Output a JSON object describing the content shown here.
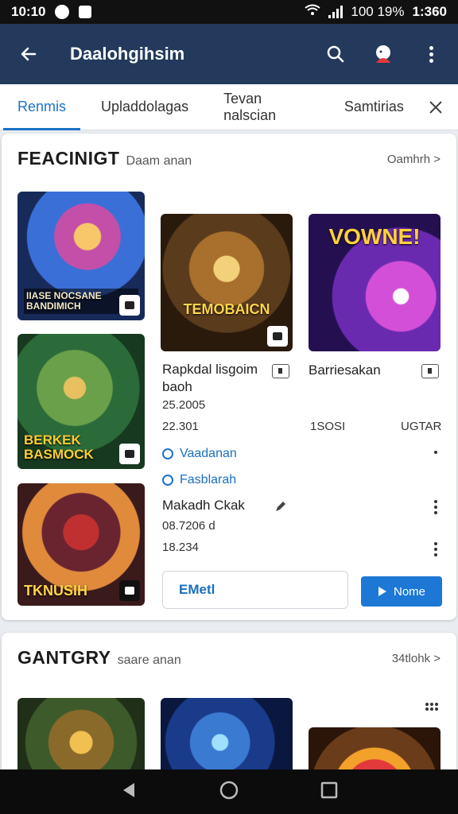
{
  "status_bar": {
    "time_left": "10:10",
    "battery": "100 19%",
    "time_right": "1:360"
  },
  "app_bar": {
    "title": "Daalohgihsim"
  },
  "tabs": [
    "Renmis",
    "Upladdolagas",
    "Tevan nalscian",
    "Samtirias"
  ],
  "section1": {
    "title": "FEACINIGT",
    "subtitle": "Daam anan",
    "see_all": "Oamhrh >",
    "tiles": {
      "t1_caption": "IIASE NOCSANE\nBANDIMICH",
      "t2_caption": "BERKEK\nBASMOCK",
      "t3_caption": "TKNUSIH",
      "t4_caption": "TEMOBAICN",
      "t5_caption": "VOWNE!"
    },
    "item1": {
      "name": "Rapkdal lisgoim\nbaoh",
      "price": "25.2005",
      "count": "22.301"
    },
    "item2": {
      "name": "Barriesakan",
      "count_a": "1SOSI",
      "count_b": "UGTAR"
    },
    "options": [
      "Vaadanan",
      "Fasblarah"
    ],
    "detail": {
      "name": "Makadh Ckak",
      "value1": "08.7206 d",
      "value2": "18.234"
    },
    "btn_outline": "EMetl",
    "btn_primary": "Nome"
  },
  "section2": {
    "title": "GANTGRY",
    "subtitle": "saare anan",
    "see_all": "34tlohk >"
  },
  "colors": {
    "primary": "#1c78d4",
    "app_bar": "#233a5c",
    "accent_text": "#1a6fbf"
  }
}
